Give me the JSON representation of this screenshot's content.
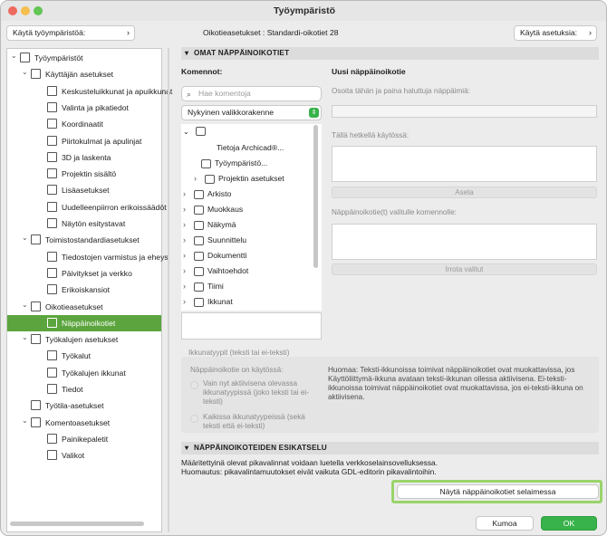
{
  "window": {
    "title": "Työympäristö",
    "colors": {
      "close": "#ed6a5e",
      "min": "#f5bf4f",
      "max": "#62c554",
      "accent": "#5ca53e",
      "ok": "#38b24a"
    }
  },
  "top": {
    "use_workspace": "Käytä työympäristöä:",
    "shortcut_scheme": "Oikotieasetukset : Standardi-oikotiet 28",
    "use_settings": "Käytä asetuksia:"
  },
  "tree": [
    "Työympäristöt",
    "Käyttäjän asetukset",
    "Keskusteluikkunat ja apuikkunat",
    "Valinta ja pikatiedot",
    "Koordinaatit",
    "Piirtokulmat ja apulinjat",
    "3D ja laskenta",
    "Projektin sisältö",
    "Lisäasetukset",
    "Uudelleenpiirron erikoissäädöt",
    "Näytön esitystavat",
    "Toimistostandardiasetukset",
    "Tiedostojen varmistus ja eheys",
    "Päivitykset ja verkko",
    "Erikoiskansiot",
    "Oikotieasetukset",
    "Näppäinoikotiet",
    "Työkalujen asetukset",
    "Työkalut",
    "Työkalujen ikkunat",
    "Tiedot",
    "Työtila-asetukset",
    "Komentoasetukset",
    "Painikepaletit",
    "Valikot"
  ],
  "section1": {
    "title": "OMAT NÄPPÄINOIKOTIET",
    "commands_label": "Komennot:",
    "search_placeholder": "Hae komentoja",
    "menu_select": "Nykyinen valikkorakenne",
    "new_shortcut_label": "Uusi näppäinoikotie",
    "click_hint": "Osoita tähän ja paina haluttuja näppäimiä:",
    "in_use_label": "Tällä hetkellä käytössä:",
    "set_button": "Aseta",
    "selected_cmd_label": "Näppäinoikotie(t) valitulle komennolle:",
    "remove_button": "Irrota valitut",
    "commands": [
      "Tietoja Archicad®...",
      "Työympäristö...",
      "Projektin asetukset",
      "Arkisto",
      "Muokkaus",
      "Näkymä",
      "Suunnittelu",
      "Dokumentti",
      "Vaihtoehdot",
      "Tiimi",
      "Ikkunat"
    ],
    "window_types_label": "Ikkunatyypit (teksti tai ei-teksti)",
    "active_in_label": "Näppäinoikotie on käytössä:",
    "radio1": "Vain nyt aktiivisena olevassa ikkunatyypissä (joko teksti tai ei-teksti)",
    "radio2": "Kaikissa ikkunatyypeissä (sekä teksti että ei-teksti)",
    "note": "Huomaa: Teksti-ikkunoissa toimivat näppäinoikotiet ovat muokattavissa, jos Käyttöliittymä-ikkuna avataan teksti-ikkunan ollessa aktiivisena. Ei-teksti-ikkunoissa toimivat näppäinoikotiet ovat muokattavissa, jos ei-teksti-ikkuna on aktiivisena."
  },
  "section2": {
    "title": "NÄPPÄINOIKOTEIDEN ESIKATSELU",
    "line1": "Määritettyinä olevat pikavalinnat voidaan luetella verkkoselainsovelluksessa.",
    "line2": "Huomautus: pikavalintamuutokset eivät vaikuta GDL-editorin pikavalintoihin.",
    "browser_button": "Näytä näppäinoikotiet selaimessa"
  },
  "footer": {
    "cancel": "Kumoa",
    "ok": "OK"
  }
}
